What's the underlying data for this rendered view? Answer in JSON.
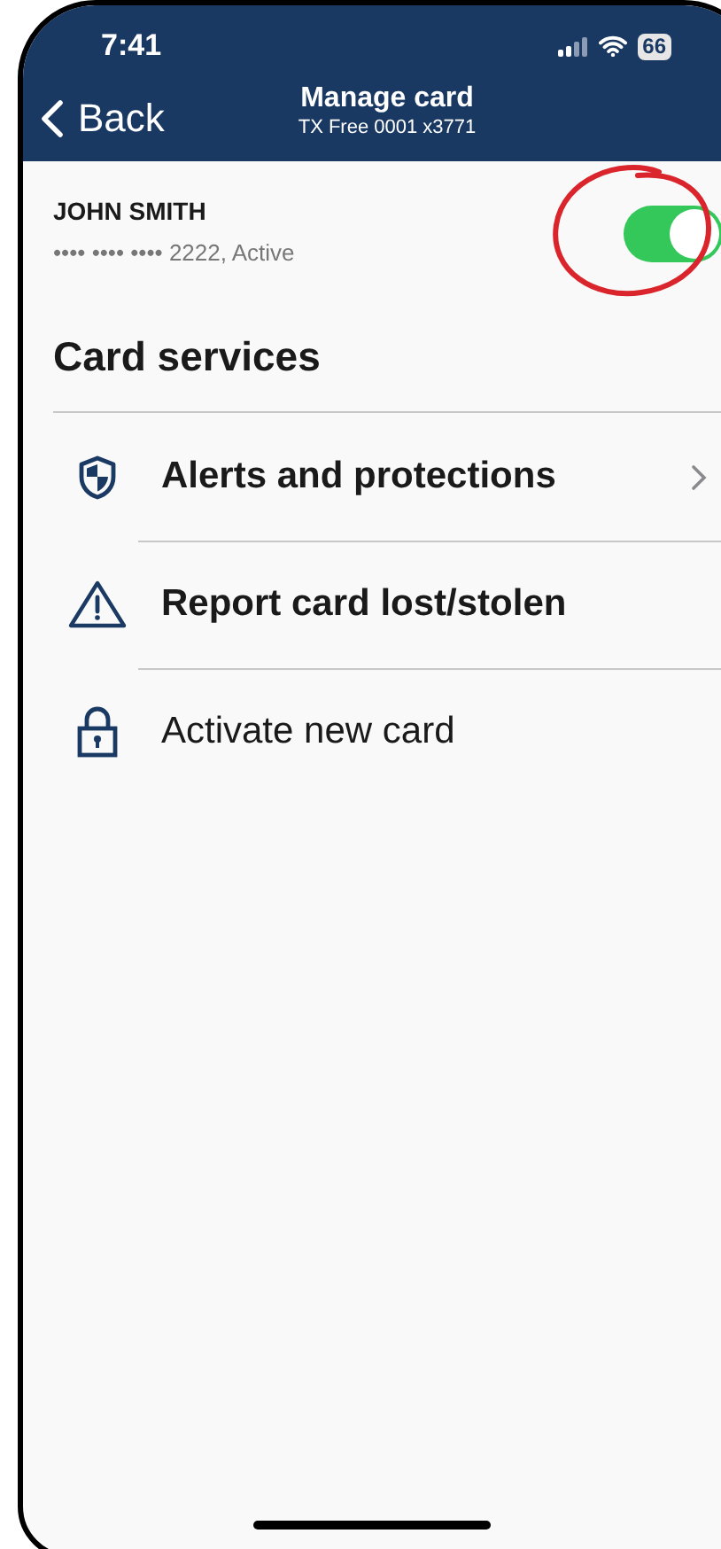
{
  "status_bar": {
    "time": "7:41",
    "battery": "66"
  },
  "nav": {
    "back": "Back",
    "title": "Manage card",
    "subtitle": "TX Free 0001 x3771"
  },
  "card": {
    "holder": "JOHN SMITH",
    "number": "•••• •••• •••• 2222, Active",
    "on": true
  },
  "section_title": "Card services",
  "services": [
    {
      "kind": "shield",
      "label": "Alerts and protections",
      "bold": true,
      "chevron": true
    },
    {
      "kind": "warning",
      "label": "Report card lost/stolen",
      "bold": true,
      "chevron": false
    },
    {
      "kind": "lock",
      "label": "Activate new card",
      "bold": false,
      "chevron": false
    }
  ]
}
